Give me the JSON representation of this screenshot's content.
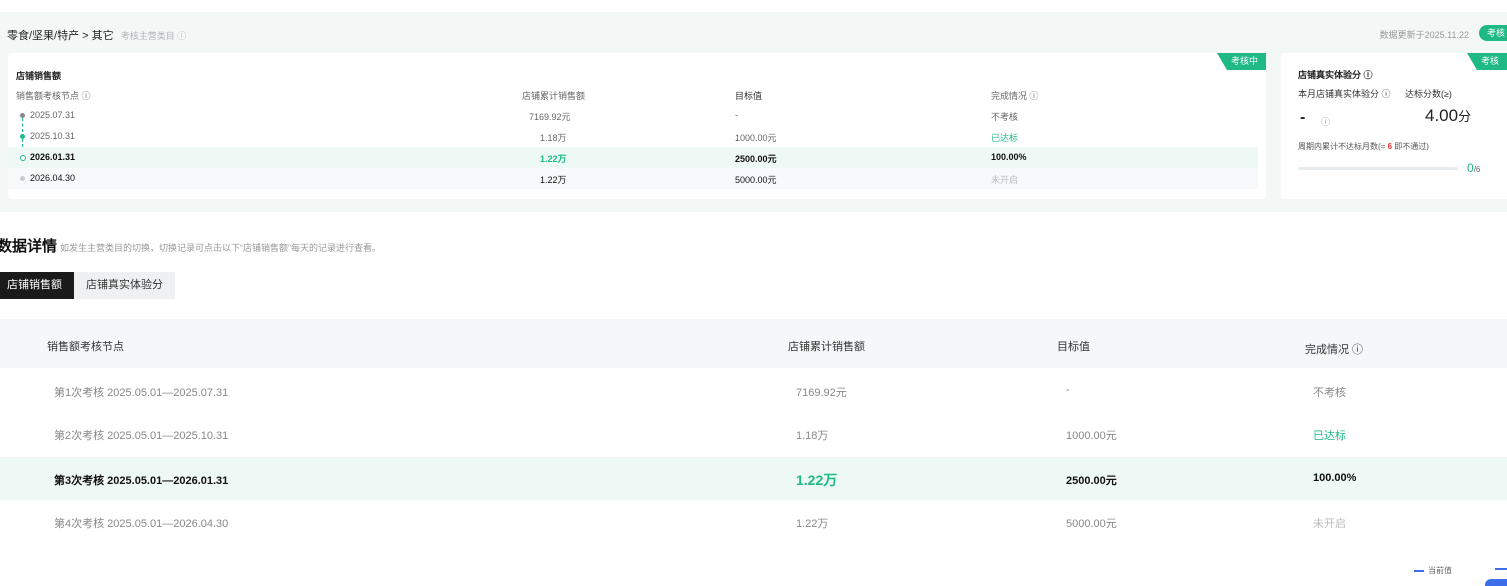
{
  "header": {
    "breadcrumb": "零食/坚果/特产 > 其它",
    "breadcrumb_hint": "考核主营类目 ⓘ",
    "data_update": "数据更新于2025.11.22",
    "status_pill": "考核"
  },
  "sales_card": {
    "ribbon": "考核中",
    "title": "店铺销售额",
    "columns": [
      "销售额考核节点 ⓘ",
      "店铺累计销售额",
      "目标值",
      "完成情况 ⓘ"
    ],
    "rows": [
      {
        "date": "2025.07.31",
        "sales": "7169.92元",
        "target": "-",
        "status": "不考核"
      },
      {
        "date": "2025.10.31",
        "sales": "1.18万",
        "target": "1000.00元",
        "status": "已达标"
      },
      {
        "date": "2026.01.31",
        "sales": "1.22万",
        "target": "2500.00元",
        "status": "100.00%"
      },
      {
        "date": "2026.04.30",
        "sales": "1.22万",
        "target": "5000.00元",
        "status": "未开启"
      }
    ]
  },
  "verify_card": {
    "ribbon": "考核",
    "title": "店铺真实体验分 ⓘ",
    "monthly_label": "本月店铺真实体验分 ⓘ",
    "threshold_label": "达标分数(≥)",
    "monthly_value": "-",
    "monthly_q": "ⓘ",
    "threshold_value": "4.00",
    "threshold_unit": "分",
    "months_label": "周期内累计不达标月数(",
    "months_mid": "= ",
    "months_red": "6",
    "months_tail": " 即不通过)",
    "progress_current": "0",
    "progress_total": "/6",
    "progress_fraction": 0
  },
  "details": {
    "title": "数据详情",
    "note": "如发生主营类目的切换，切换记录可点击以下“店铺销售额”每天的记录进行查看。",
    "tabs": [
      "店铺销售额",
      "店铺真实体验分"
    ],
    "columns": [
      "销售额考核节点",
      "店铺累计销售额",
      "目标值",
      "完成情况 ⓘ"
    ],
    "rows": [
      {
        "period": "第1次考核 2025.05.01—2025.07.31",
        "sales": "7169.92元",
        "target": "-",
        "status": "不考核"
      },
      {
        "period": "第2次考核 2025.05.01—2025.10.31",
        "sales": "1.18万",
        "target": "1000.00元",
        "status": "已达标"
      },
      {
        "period": "第3次考核 2025.05.01—2026.01.31",
        "sales": "1.22万",
        "target": "2500.00元",
        "status": "100.00%"
      },
      {
        "period": "第4次考核 2025.05.01—2026.04.30",
        "sales": "1.22万",
        "target": "5000.00元",
        "status": "未开启"
      }
    ]
  },
  "legend": {
    "current": "当前值"
  },
  "colors": {
    "accent": "#1fb985",
    "dark_tab": "#1a1a1a",
    "highlight_row": "#eef8f4",
    "legend_blue": "#3b6ee8",
    "red": "#e33333"
  }
}
